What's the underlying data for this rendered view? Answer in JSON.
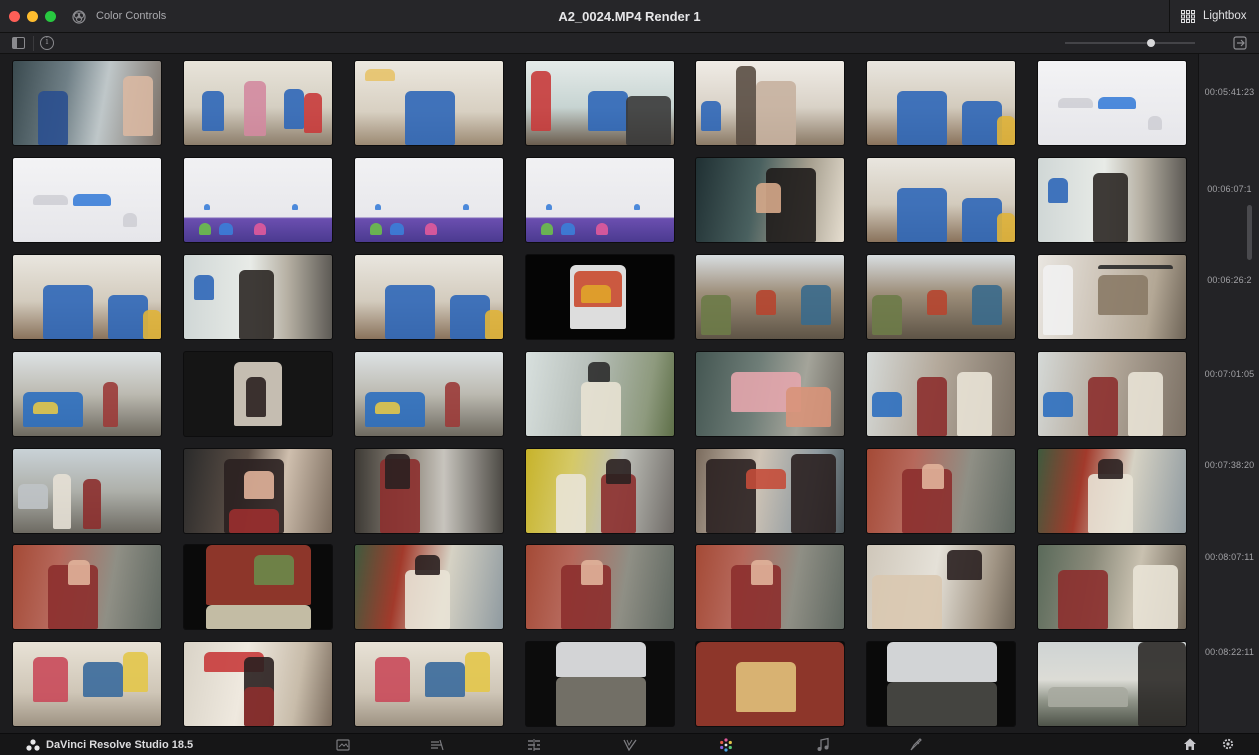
{
  "titlebar": {
    "panel_label": "Color Controls",
    "window_title": "A2_0024.MP4 Render 1",
    "lightbox_label": "Lightbox"
  },
  "timecodes": [
    "00:05:41:23",
    "00:06:07:1",
    "00:06:26:2",
    "00:07:01:05",
    "00:07:38:20",
    "00:08:07:11",
    "00:08:22:11"
  ],
  "footer": {
    "app_name": "DaVinci Resolve Studio 18.5",
    "pages": [
      "media-page-icon",
      "cut-page-icon",
      "edit-page-icon",
      "fusion-page-icon",
      "color-page-icon",
      "fairlight-page-icon",
      "deliver-page-icon"
    ],
    "active_page": "color-page-icon"
  },
  "colors": {
    "accent_active": "#e05a9b",
    "background": "#1c1c1e"
  },
  "thumbnails": [
    [
      "street cafe scene",
      "office dance",
      "office presenter",
      "office lounge",
      "woman at shelf",
      "office group",
      "ui screenshot"
    ],
    [
      "ui screenshot",
      "taskbar screenshot",
      "taskbar screenshot",
      "taskbar screenshot",
      "woman profile",
      "office group",
      "woman at door"
    ],
    [
      "office group",
      "woman at door",
      "office group",
      "phone photo",
      "market street",
      "market street",
      "car interior"
    ],
    [
      "tuk-tuk street",
      "woman portrait",
      "tuk-tuk street",
      "man with camera",
      "pink camera",
      "couple street",
      "couple street"
    ],
    [
      "couple walking",
      "woman portrait",
      "woman walking",
      "couple mural",
      "man and woman",
      "woman with camera",
      "man sitting"
    ],
    [
      "woman with camera",
      "camera view",
      "man sitting",
      "woman with camera",
      "woman with camera",
      "man pointing",
      "couple laughing"
    ],
    [
      "poster wall",
      "love mural",
      "poster wall",
      "temple street",
      "temple street",
      "city view",
      "river view"
    ]
  ]
}
